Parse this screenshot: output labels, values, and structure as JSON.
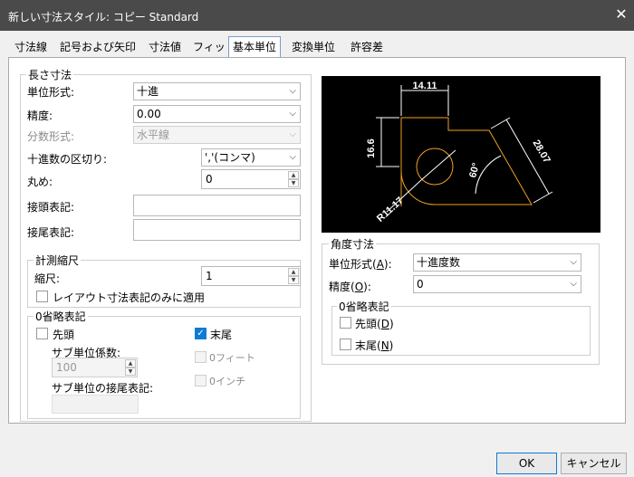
{
  "window": {
    "title": "新しい寸法スタイル: コピー Standard",
    "close_glyph": "✕"
  },
  "tabs": [
    {
      "label": "寸法線"
    },
    {
      "label": "記号および矢印"
    },
    {
      "label": "寸法値"
    },
    {
      "label": "フィット"
    },
    {
      "label": "基本単位",
      "active": true
    },
    {
      "label": "変換単位"
    },
    {
      "label": "許容差"
    }
  ],
  "linear": {
    "group_title": "長さ寸法",
    "unit_format": {
      "label": "単位形式:",
      "value": "十進"
    },
    "precision": {
      "label": "精度:",
      "value": "0.00"
    },
    "fraction_format": {
      "label": "分数形式:",
      "value": "水平線"
    },
    "decimal_separator": {
      "label": "十進数の区切り:",
      "value": "','(コンマ)"
    },
    "round_off": {
      "label": "丸め:",
      "value": "0"
    },
    "prefix": {
      "label": "接頭表記:",
      "value": ""
    },
    "suffix": {
      "label": "接尾表記:",
      "value": ""
    }
  },
  "scale": {
    "group_title": "計測縮尺",
    "factor": {
      "label": "縮尺:",
      "value": "1"
    },
    "layout_only": {
      "label": "レイアウト寸法表記のみに適用",
      "checked": false
    }
  },
  "zero_suppression": {
    "group_title": "0省略表記",
    "leading": {
      "label": "先頭",
      "checked": false
    },
    "sub_unit_factor": {
      "label": "サブ単位係数:",
      "value": "100"
    },
    "sub_unit_suffix": {
      "label": "サブ単位の接尾表記:"
    },
    "trailing": {
      "label": "末尾",
      "checked": true
    },
    "feet": {
      "label": "0フィート"
    },
    "inches": {
      "label": "0インチ"
    }
  },
  "preview": {
    "dim_top": "14.11",
    "dim_left": "16.6",
    "dim_right": "28.07",
    "dim_angle": "60°",
    "dim_radius": "R11.17",
    "colors": {
      "background": "#000000",
      "geometry": "#f0a020",
      "dimension": "#ffffff"
    }
  },
  "angular": {
    "group_title": "角度寸法",
    "unit_format": {
      "label": "単位形式(",
      "hotkey": "A",
      "label_end": "):",
      "value": "十進度数"
    },
    "precision": {
      "label": "精度(",
      "hotkey": "O",
      "label_end": "):",
      "value": "0"
    },
    "zero_suppression": {
      "group_title": "0省略表記",
      "leading": {
        "label": "先頭(",
        "hotkey": "D",
        "label_end": ")",
        "checked": false
      },
      "trailing": {
        "label": "末尾(",
        "hotkey": "N",
        "label_end": ")",
        "checked": false
      }
    }
  },
  "buttons": {
    "ok": "OK",
    "cancel": "キャンセル"
  },
  "icons": {
    "chevron": "chevron-down-icon",
    "check": "checkmark-icon",
    "spin_up": "▲",
    "spin_down": "▼",
    "chevron_glyph": "⌵",
    "check_glyph": "✓"
  }
}
